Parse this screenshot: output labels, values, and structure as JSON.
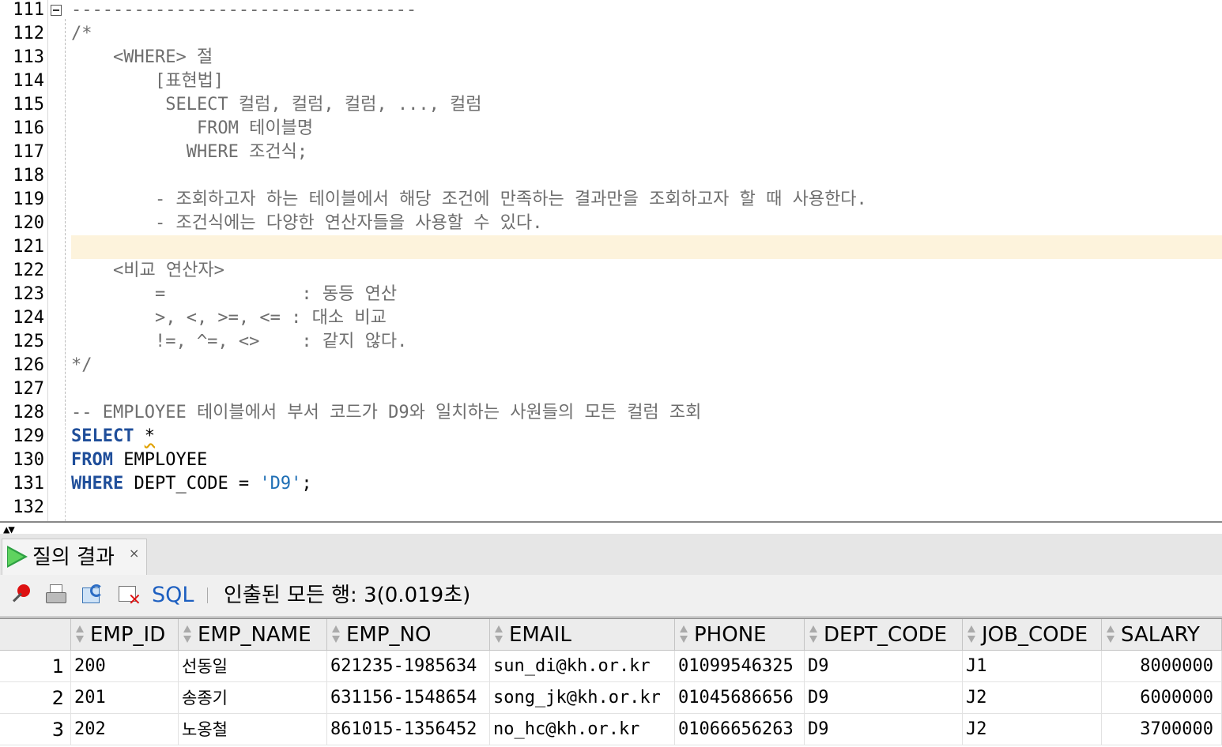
{
  "editor": {
    "lines": [
      {
        "no": "111",
        "text": "---------------------------------",
        "kind": "comment"
      },
      {
        "no": "112",
        "text": "/*",
        "kind": "comment"
      },
      {
        "no": "113",
        "text": "    <WHERE> 절",
        "kind": "comment"
      },
      {
        "no": "114",
        "text": "        [표현법]",
        "kind": "comment"
      },
      {
        "no": "115",
        "text": "         SELECT 컬럼, 컬럼, 컬럼, ..., 컬럼",
        "kind": "comment"
      },
      {
        "no": "116",
        "text": "            FROM 테이블명",
        "kind": "comment"
      },
      {
        "no": "117",
        "text": "           WHERE 조건식;",
        "kind": "comment"
      },
      {
        "no": "118",
        "text": "",
        "kind": "comment"
      },
      {
        "no": "119",
        "text": "        - 조회하고자 하는 테이블에서 해당 조건에 만족하는 결과만을 조회하고자 할 때 사용한다.",
        "kind": "comment"
      },
      {
        "no": "120",
        "text": "        - 조건식에는 다양한 연산자들을 사용할 수 있다.",
        "kind": "comment"
      },
      {
        "no": "121",
        "text": "",
        "kind": "comment"
      },
      {
        "no": "122",
        "text": "    <비교 연산자>",
        "kind": "comment"
      },
      {
        "no": "123",
        "text": "        =             : 동등 연산",
        "kind": "comment"
      },
      {
        "no": "124",
        "text": "        >, <, >=, <= : 대소 비교",
        "kind": "comment"
      },
      {
        "no": "125",
        "text": "        !=, ^=, <>    : 같지 않다.",
        "kind": "comment"
      },
      {
        "no": "126",
        "text": "*/",
        "kind": "comment"
      },
      {
        "no": "127",
        "text": "",
        "kind": "comment"
      },
      {
        "no": "128",
        "text": "-- EMPLOYEE 테이블에서 부서 코드가 D9와 일치하는 사원들의 모든 컬럼 조회",
        "kind": "comment"
      },
      {
        "no": "129",
        "text": "",
        "kind": "code"
      },
      {
        "no": "130",
        "text": "",
        "kind": "code"
      },
      {
        "no": "131",
        "text": "",
        "kind": "code"
      },
      {
        "no": "132",
        "text": "",
        "kind": "code"
      }
    ],
    "sql": {
      "select_kw": "SELECT",
      "star": "*",
      "from_kw": "FROM",
      "table": "EMPLOYEE",
      "where_kw": "WHERE",
      "condition": "DEPT_CODE = ",
      "value": "'D9'",
      "terminator": ";"
    },
    "current_line": "121"
  },
  "results": {
    "tab_label": "질의 결과",
    "tab_close": "×",
    "toolbar": {
      "icons": [
        "pin-icon",
        "print-icon",
        "refresh-icon",
        "cancel-icon"
      ],
      "sql_label": "SQL",
      "status": "인출된 모든 행: 3(0.019초)"
    },
    "columns": [
      "EMP_ID",
      "EMP_NAME",
      "EMP_NO",
      "EMAIL",
      "PHONE",
      "DEPT_CODE",
      "JOB_CODE",
      "SALARY"
    ],
    "rows": [
      {
        "n": "1",
        "EMP_ID": "200",
        "EMP_NAME": "선동일",
        "EMP_NO": "621235-1985634",
        "EMAIL": "sun_di@kh.or.kr",
        "PHONE": "01099546325",
        "DEPT_CODE": "D9",
        "JOB_CODE": "J1",
        "SALARY": "8000000"
      },
      {
        "n": "2",
        "EMP_ID": "201",
        "EMP_NAME": "송종기",
        "EMP_NO": "631156-1548654",
        "EMAIL": "song_jk@kh.or.kr",
        "PHONE": "01045686656",
        "DEPT_CODE": "D9",
        "JOB_CODE": "J2",
        "SALARY": "6000000"
      },
      {
        "n": "3",
        "EMP_ID": "202",
        "EMP_NAME": "노옹철",
        "EMP_NO": "861015-1356452",
        "EMAIL": "no_hc@kh.or.kr",
        "PHONE": "01066656263",
        "DEPT_CODE": "D9",
        "JOB_CODE": "J2",
        "SALARY": "3700000"
      }
    ]
  },
  "colors": {
    "keyword": "#1f4e9a",
    "string": "#1f6fb5",
    "comment": "#6e6e6e",
    "current_line_bg": "#fdf3dc",
    "link": "#1d5fc0"
  }
}
